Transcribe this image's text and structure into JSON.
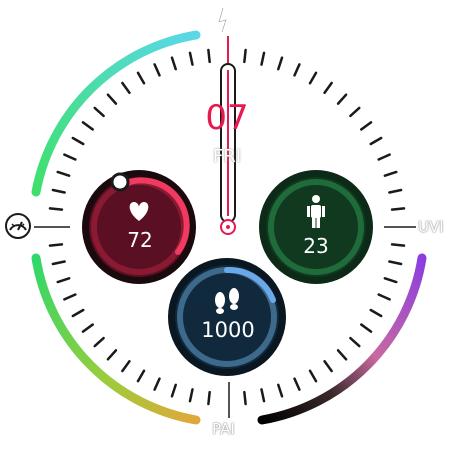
{
  "date": {
    "day": "07",
    "weekday": "FRI"
  },
  "complications": {
    "heart_rate": {
      "value": "72",
      "icon": "heart-icon",
      "ring_color": "#e8194f",
      "bg_color": "#5a0f22"
    },
    "body": {
      "value": "23",
      "icon": "person-icon",
      "ring_color": "#1f6b3a",
      "bg_color": "#0f3a24"
    },
    "steps": {
      "value": "1000",
      "icon": "footprints-icon",
      "ring_color": "#3d6a8a",
      "bg_color": "#10293d"
    }
  },
  "side_labels": {
    "uvi": "UVI",
    "pai": "PAI"
  },
  "icons": {
    "top": "lightning-icon",
    "left": "stress-gauge-icon"
  },
  "colors": {
    "hand": "#e8194f",
    "ticks": "#1a1a1a",
    "background": "#ffffff"
  }
}
